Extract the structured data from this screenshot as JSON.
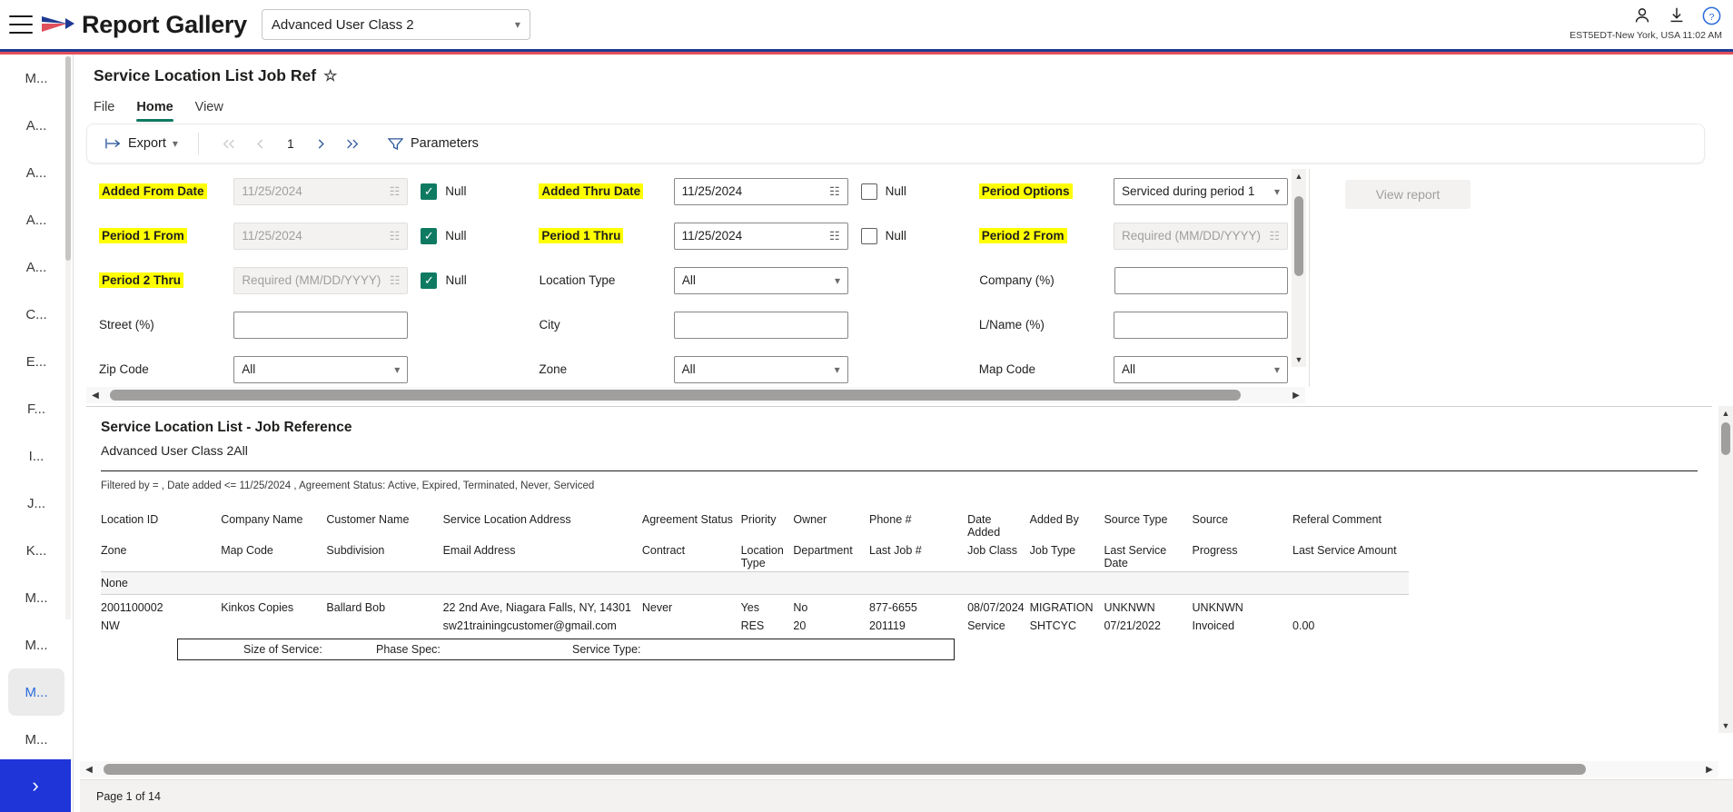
{
  "topbar": {
    "brand": "Report Gallery",
    "class_selector_value": "Advanced User Class 2",
    "timezone_text": "EST5EDT-New York, USA 11:02 AM",
    "icons": {
      "user": "user-icon",
      "download": "download-icon",
      "help": "help-icon"
    }
  },
  "sidebar": {
    "items": [
      {
        "label": "M...",
        "active": false
      },
      {
        "label": "A...",
        "active": false
      },
      {
        "label": "A...",
        "active": false
      },
      {
        "label": "A...",
        "active": false
      },
      {
        "label": "A...",
        "active": false
      },
      {
        "label": "C...",
        "active": false
      },
      {
        "label": "E...",
        "active": false
      },
      {
        "label": "F...",
        "active": false
      },
      {
        "label": "I...",
        "active": false
      },
      {
        "label": "J...",
        "active": false
      },
      {
        "label": "K...",
        "active": false
      },
      {
        "label": "M...",
        "active": false
      },
      {
        "label": "M...",
        "active": false
      },
      {
        "label": "M...",
        "active": true
      },
      {
        "label": "M...",
        "active": false
      }
    ],
    "expand_label": "›"
  },
  "report": {
    "title": "Service Location List Job Ref",
    "favorite_icon": "☆",
    "tabs": [
      {
        "label": "File",
        "active": false
      },
      {
        "label": "Home",
        "active": true
      },
      {
        "label": "View",
        "active": false
      }
    ],
    "toolbar": {
      "export_label": "Export",
      "first_page": "⏪",
      "prev_page": "◁",
      "page_number": "1",
      "next_page": "▷",
      "last_page": "⏩",
      "parameters_label": "Parameters"
    },
    "view_report_button": "View report"
  },
  "parameters": {
    "rows": [
      {
        "left": {
          "label": "Added From Date",
          "highlight": true,
          "value": "11/25/2024",
          "disabled": true,
          "type": "date",
          "null_label": "Null",
          "null_checked": true
        },
        "mid": {
          "label": "Added Thru Date",
          "highlight": true,
          "value": "11/25/2024",
          "disabled": false,
          "type": "date",
          "null_label": "Null",
          "null_checked": false
        },
        "right": {
          "label": "Period Options",
          "highlight": true,
          "value": "Serviced during period 1",
          "disabled": false,
          "type": "select"
        }
      },
      {
        "left": {
          "label": "Period 1 From",
          "highlight": true,
          "value": "11/25/2024",
          "disabled": true,
          "type": "date",
          "null_label": "Null",
          "null_checked": true
        },
        "mid": {
          "label": "Period 1 Thru",
          "highlight": true,
          "value": "11/25/2024",
          "disabled": false,
          "type": "date",
          "null_label": "Null",
          "null_checked": false
        },
        "right": {
          "label": "Period 2 From",
          "highlight": true,
          "value": "Required (MM/DD/YYYY)",
          "disabled": true,
          "type": "date"
        }
      },
      {
        "left": {
          "label": "Period 2 Thru",
          "highlight": true,
          "value": "Required (MM/DD/YYYY)",
          "disabled": true,
          "type": "date",
          "null_label": "Null",
          "null_checked": true
        },
        "mid": {
          "label": "Location Type",
          "highlight": false,
          "value": "All",
          "disabled": false,
          "type": "select"
        },
        "right": {
          "label": "Company (%)",
          "highlight": false,
          "value": "",
          "disabled": false,
          "type": "text"
        }
      },
      {
        "left": {
          "label": "Street (%)",
          "highlight": false,
          "value": "",
          "disabled": false,
          "type": "text"
        },
        "mid": {
          "label": "City",
          "highlight": false,
          "value": "",
          "disabled": false,
          "type": "text"
        },
        "right": {
          "label": "L/Name (%)",
          "highlight": false,
          "value": "",
          "disabled": false,
          "type": "text"
        }
      },
      {
        "left": {
          "label": "Zip Code",
          "highlight": false,
          "value": "All",
          "disabled": false,
          "type": "select"
        },
        "mid": {
          "label": "Zone",
          "highlight": false,
          "value": "All",
          "disabled": false,
          "type": "select"
        },
        "right": {
          "label": "Map Code",
          "highlight": false,
          "value": "All",
          "disabled": false,
          "type": "select"
        }
      }
    ]
  },
  "report_body": {
    "title": "Service Location List - Job Reference",
    "subtitle": "Advanced User Class 2All",
    "filter_text": "Filtered by = , Date added <= 11/25/2024 , Agreement Status: Active, Expired, Terminated, Never, Serviced",
    "headers_row1": [
      "Location ID",
      "Company Name",
      "Customer Name",
      "Service Location Address",
      "Agreement Status",
      "Priority",
      "Owner",
      "Phone #",
      "Date Added",
      "Added By",
      "Source Type",
      "Source",
      "Referal Comment"
    ],
    "headers_row2": [
      "Zone",
      "Map Code",
      "Subdivision",
      "Email Address",
      "Contract",
      "Location Type",
      "Department",
      "Last Job #",
      "Job Class",
      "Job Type",
      "Last Service Date",
      "Progress",
      "Last Service Amount"
    ],
    "group_label": "None",
    "rows": [
      {
        "line1": [
          "2001100002",
          "Kinkos Copies",
          "Ballard Bob",
          "22 2nd Ave, Niagara Falls, NY, 14301",
          "Never",
          "Yes",
          "No",
          "877-6655",
          "08/07/2024",
          "MIGRATION",
          "UNKNWN",
          "UNKNWN",
          ""
        ],
        "line2": [
          "NW",
          "",
          "",
          "sw21trainingcustomer@gmail.com",
          "",
          "RES",
          "20",
          "201119",
          "Service",
          "SHTCYC",
          "07/21/2022",
          "Invoiced",
          "0.00"
        ]
      }
    ],
    "sub_fields": [
      {
        "label": "Size of Service:"
      },
      {
        "label": "Phase Spec:"
      },
      {
        "label": "Service Type:"
      }
    ]
  },
  "statusbar": {
    "page_info": "Page 1 of 14"
  }
}
